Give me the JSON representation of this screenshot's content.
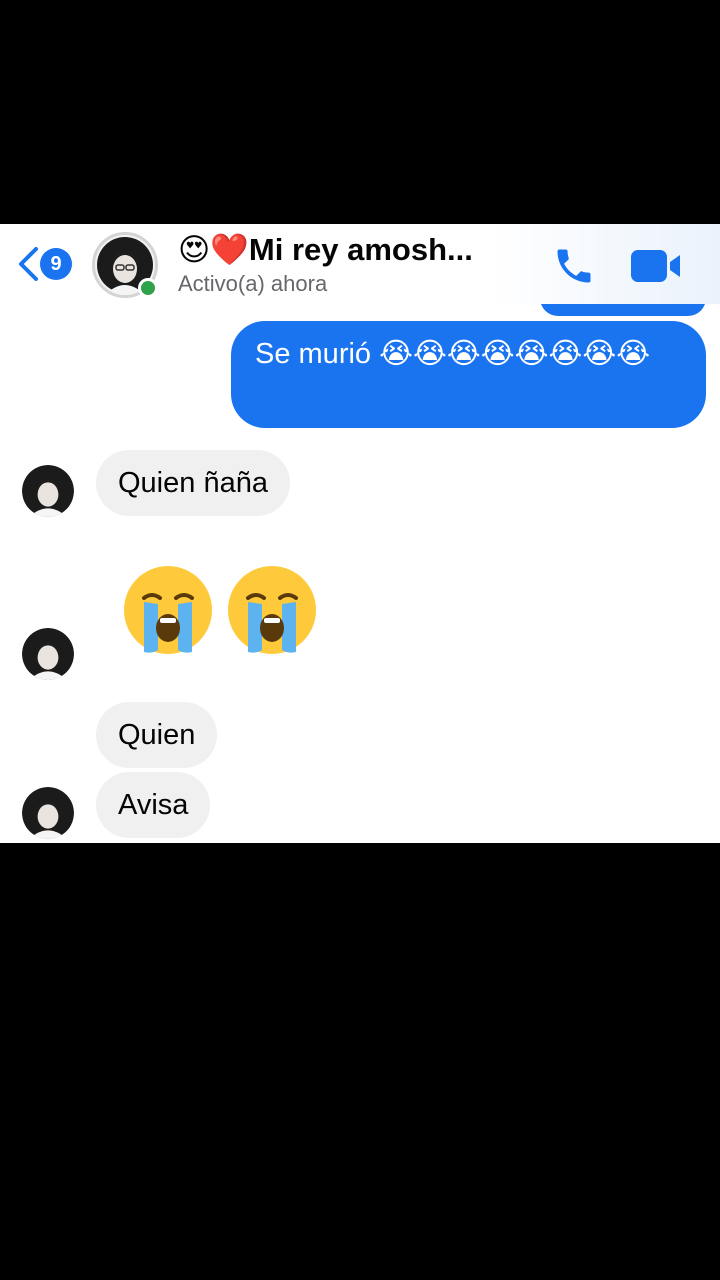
{
  "header": {
    "back_count": "9",
    "title": "😍❤️Mi rey amosh...",
    "status": "Activo(a) ahora"
  },
  "messages": {
    "sent_text": "Se murió 😭😭😭😭😭😭😭😭",
    "recv_1": "Quien ñaña",
    "recv_2": "Quien",
    "recv_3": "Avisa"
  },
  "colors": {
    "accent": "#1a74f0",
    "received_bubble": "#f0f0f0",
    "online": "#31a24c"
  },
  "icons": [
    "back-chevron-icon",
    "phone-icon",
    "video-camera-icon",
    "crying-face-emoji"
  ]
}
